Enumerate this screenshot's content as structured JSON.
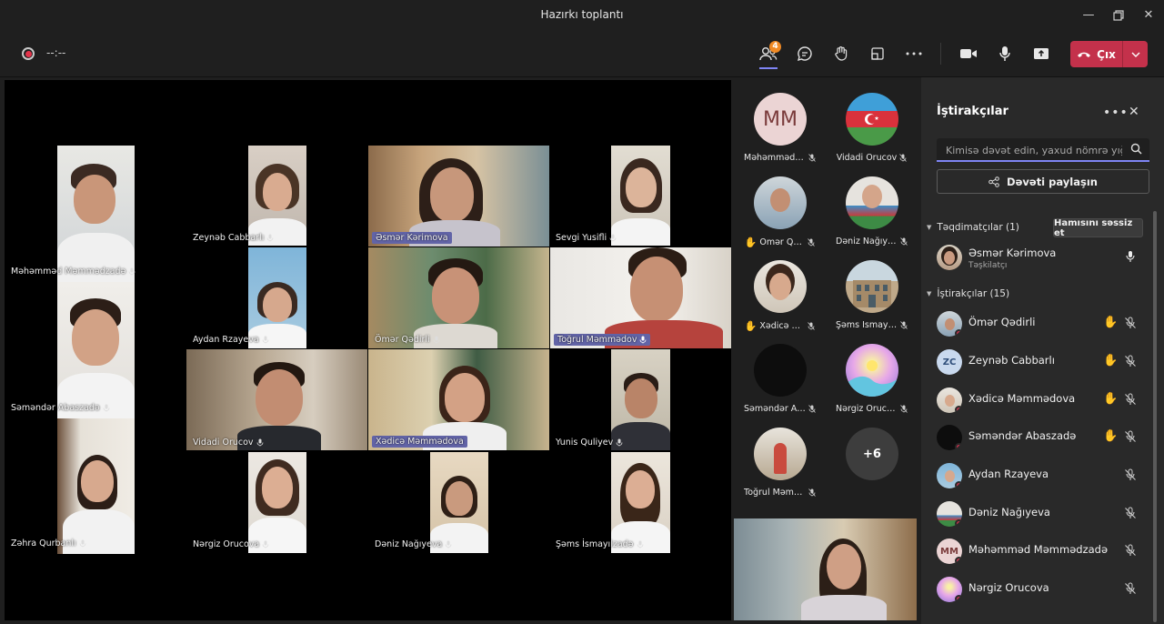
{
  "window": {
    "title": "Hazırkı toplantı"
  },
  "toolbar": {
    "timer": "--:--",
    "people_badge": "4",
    "leave_label": "Çıx"
  },
  "stage": {
    "tiles": [
      {
        "name": "Məhəmməd Məmmədzadə"
      },
      {
        "name": "Zeynəb Cabbarlı"
      },
      {
        "name": "Əsmər Kərimova"
      },
      {
        "name": "Sevgi Yusifli"
      },
      {
        "name": "Aydan Rzayeva"
      },
      {
        "name": "Ömər Qədirli"
      },
      {
        "name": "Toğrul Məmmədov"
      },
      {
        "name": "Səməndər Abaszadə"
      },
      {
        "name": "Vidadi Orucov"
      },
      {
        "name": "Xədicə Məmmədova"
      },
      {
        "name": "Yunis Quliyev"
      },
      {
        "name": "Zəhra Qurbanlı"
      },
      {
        "name": "Nərgiz Orucova"
      },
      {
        "name": "Dəniz Nağıyeva"
      },
      {
        "name": "Şəms İsmayılzadə"
      }
    ]
  },
  "grid": {
    "cells": [
      {
        "name": "Məhəmməd Məmmədzadə",
        "initials": "MM"
      },
      {
        "name": "Vidadi Orucov"
      },
      {
        "name": "Ömər Qədirli"
      },
      {
        "name": "Dəniz Nağıyeva"
      },
      {
        "name": "Xədicə Məmmədova"
      },
      {
        "name": "Şəms İsmayılzadə"
      },
      {
        "name": "Səməndər Abaszadə"
      },
      {
        "name": "Nərgiz Orucova"
      },
      {
        "name": "Toğrul Məmmədov"
      }
    ],
    "more_count": "+6"
  },
  "panel": {
    "title": "İştirakçılar",
    "search_placeholder": "Kimisə dəvət edin, yaxud nömrə yığın",
    "share_label": "Dəvəti paylaşın",
    "presenters_header": "Təqdimatçılar (1)",
    "mute_all_label": "Hamısını səssiz et",
    "presenter": {
      "name": "Əsmər Kərimova",
      "role": "Təşkilatçı"
    },
    "attendees_header": "İştirakçılar (15)",
    "attendees": [
      {
        "name": "Ömər Qədirli",
        "hand": true
      },
      {
        "name": "Zeynəb Cabbarlı",
        "hand": true,
        "initials": "ZC"
      },
      {
        "name": "Xədicə Məmmədova",
        "hand": true
      },
      {
        "name": "Səməndər Abaszadə",
        "hand": true
      },
      {
        "name": "Aydan Rzayeva",
        "hand": false
      },
      {
        "name": "Dəniz Nağıyeva",
        "hand": false
      },
      {
        "name": "Məhəmməd Məmmədzadə",
        "hand": false,
        "initials": "MM"
      },
      {
        "name": "Nərgiz Orucova",
        "hand": false
      }
    ]
  },
  "colors": {
    "accent": "#6264a7",
    "leave": "#c4314b",
    "hand": "#f4c542",
    "badge": "#f08a24"
  }
}
